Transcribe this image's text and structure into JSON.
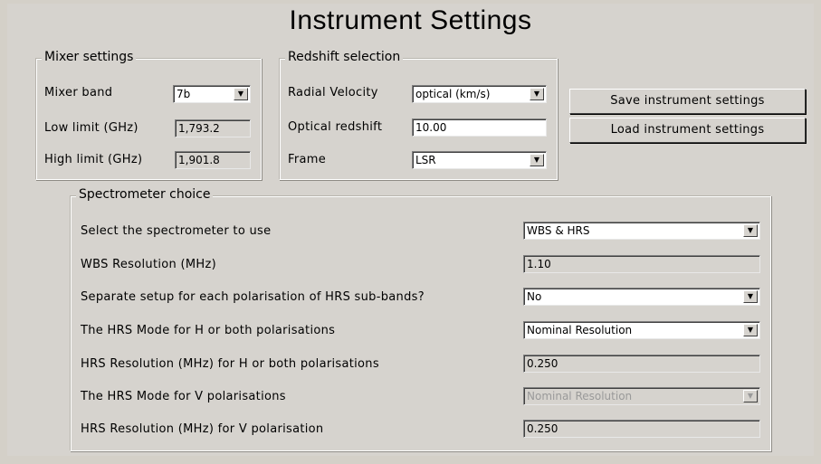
{
  "window": {
    "title": "Instrument Settings"
  },
  "mixer": {
    "legend": "Mixer settings",
    "band_label": "Mixer band",
    "band_value": "7b",
    "low_label": "Low limit (GHz)",
    "low_value": "1,793.2",
    "high_label": "High limit (GHz)",
    "high_value": "1,901.8"
  },
  "redshift": {
    "legend": "Redshift selection",
    "radial_label": "Radial Velocity",
    "radial_value": "optical (km/s)",
    "optical_label": "Optical redshift",
    "optical_value": "10.00",
    "frame_label": "Frame",
    "frame_value": "LSR"
  },
  "buttons": {
    "save": "Save instrument settings",
    "load": "Load instrument settings"
  },
  "spectrometer": {
    "legend": "Spectrometer choice",
    "rows": [
      {
        "label": "Select the spectrometer to use",
        "value": "WBS & HRS"
      },
      {
        "label": "WBS Resolution (MHz)",
        "value": "1.10"
      },
      {
        "label": "Separate setup for each polarisation of HRS sub-bands?",
        "value": "No"
      },
      {
        "label": "The HRS Mode for H or both polarisations",
        "value": "Nominal Resolution"
      },
      {
        "label": "HRS Resolution (MHz) for H or both polarisations",
        "value": "0.250"
      },
      {
        "label": "The HRS Mode for V polarisations",
        "value": "Nominal Resolution"
      },
      {
        "label": "HRS Resolution (MHz) for V polarisation",
        "value": "0.250"
      }
    ]
  },
  "icons": {
    "dropdown": "chevron-down-icon",
    "dropdown_glyph": "▼"
  }
}
